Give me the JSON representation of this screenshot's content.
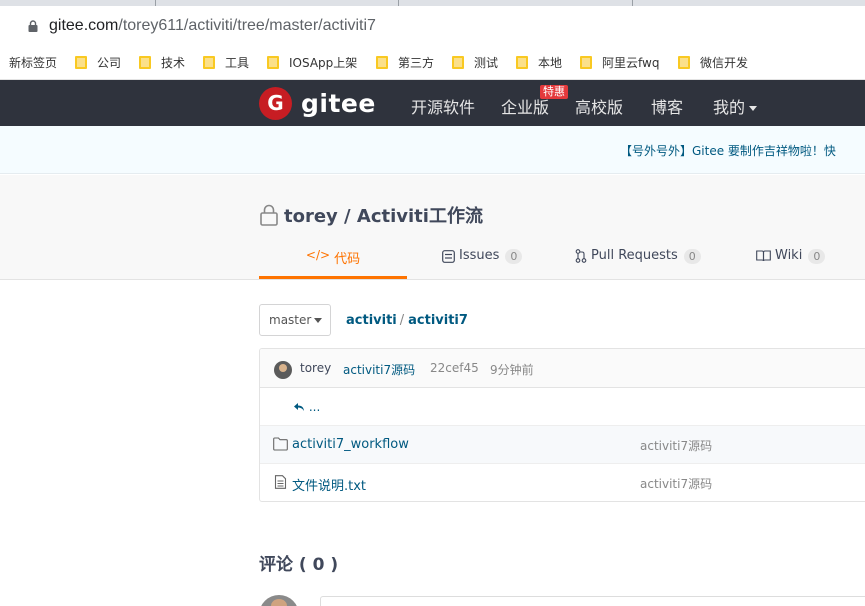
{
  "browser": {
    "url_host": "gitee.com",
    "url_path": "/torey611/activiti/tree/master/activiti7"
  },
  "bookmarks": {
    "new_tab": "新标签页",
    "items": [
      "公司",
      "技术",
      "工具",
      "IOSApp上架",
      "第三方",
      "测试",
      "本地",
      "阿里云fwq",
      "微信开发"
    ]
  },
  "header": {
    "logo_letter": "G",
    "logo_text": "gitee",
    "nav": [
      "开源软件",
      "企业版",
      "高校版",
      "博客",
      "我的"
    ],
    "badge": "特惠"
  },
  "announcement": "【号外号外】Gitee 要制作吉祥物啦！快",
  "project": {
    "title": "torey / Activiti工作流",
    "tabs": [
      {
        "label": "代码",
        "count": ""
      },
      {
        "label": "Issues",
        "count": "0"
      },
      {
        "label": "Pull Requests",
        "count": "0"
      },
      {
        "label": "Wiki",
        "count": "0"
      }
    ]
  },
  "repo": {
    "branch": "master",
    "breadcrumb": [
      "activiti",
      "activiti7"
    ],
    "commit": {
      "author": "torey",
      "message": "activiti7源码",
      "sha": "22cef45",
      "time": "9分钟前"
    },
    "parent": "...",
    "files": [
      {
        "name": "activiti7_workflow",
        "type": "folder",
        "message": "activiti7源码"
      },
      {
        "name": "文件说明.txt",
        "type": "file",
        "message": "activiti7源码"
      }
    ]
  },
  "comments": {
    "title": "评论 ( 0 )"
  },
  "colors": {
    "header_bg": "#2f333d",
    "brand_red": "#c71d23",
    "active_tab": "#fe7300",
    "link": "#005980"
  }
}
